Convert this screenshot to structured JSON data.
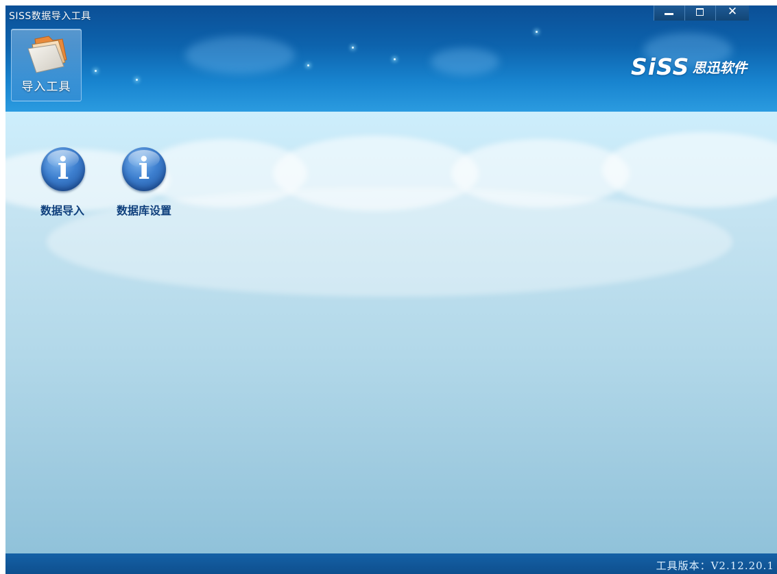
{
  "window": {
    "title": "SISS数据导入工具",
    "controls": {
      "minimize_glyph": "—",
      "close_glyph": "✕"
    }
  },
  "toolbar": {
    "import_tool": {
      "label": "导入工具",
      "icon": "folder-icon"
    }
  },
  "brand": {
    "name": "SiSS",
    "sub": "思迅软件"
  },
  "functions": [
    {
      "label": "数据导入",
      "icon": "info-icon",
      "glyph": "i"
    },
    {
      "label": "数据库设置",
      "icon": "info-icon",
      "glyph": "i"
    }
  ],
  "status_bar": {
    "version": "工具版本：V2.12.20.1"
  },
  "colors": {
    "header_top": "#0b4f96",
    "header_bottom": "#2b9be0",
    "content_top": "#cdeefc",
    "content_bottom": "#90c2da",
    "status_bar": "#0e4f8e",
    "label_text": "#0e3f7c"
  }
}
